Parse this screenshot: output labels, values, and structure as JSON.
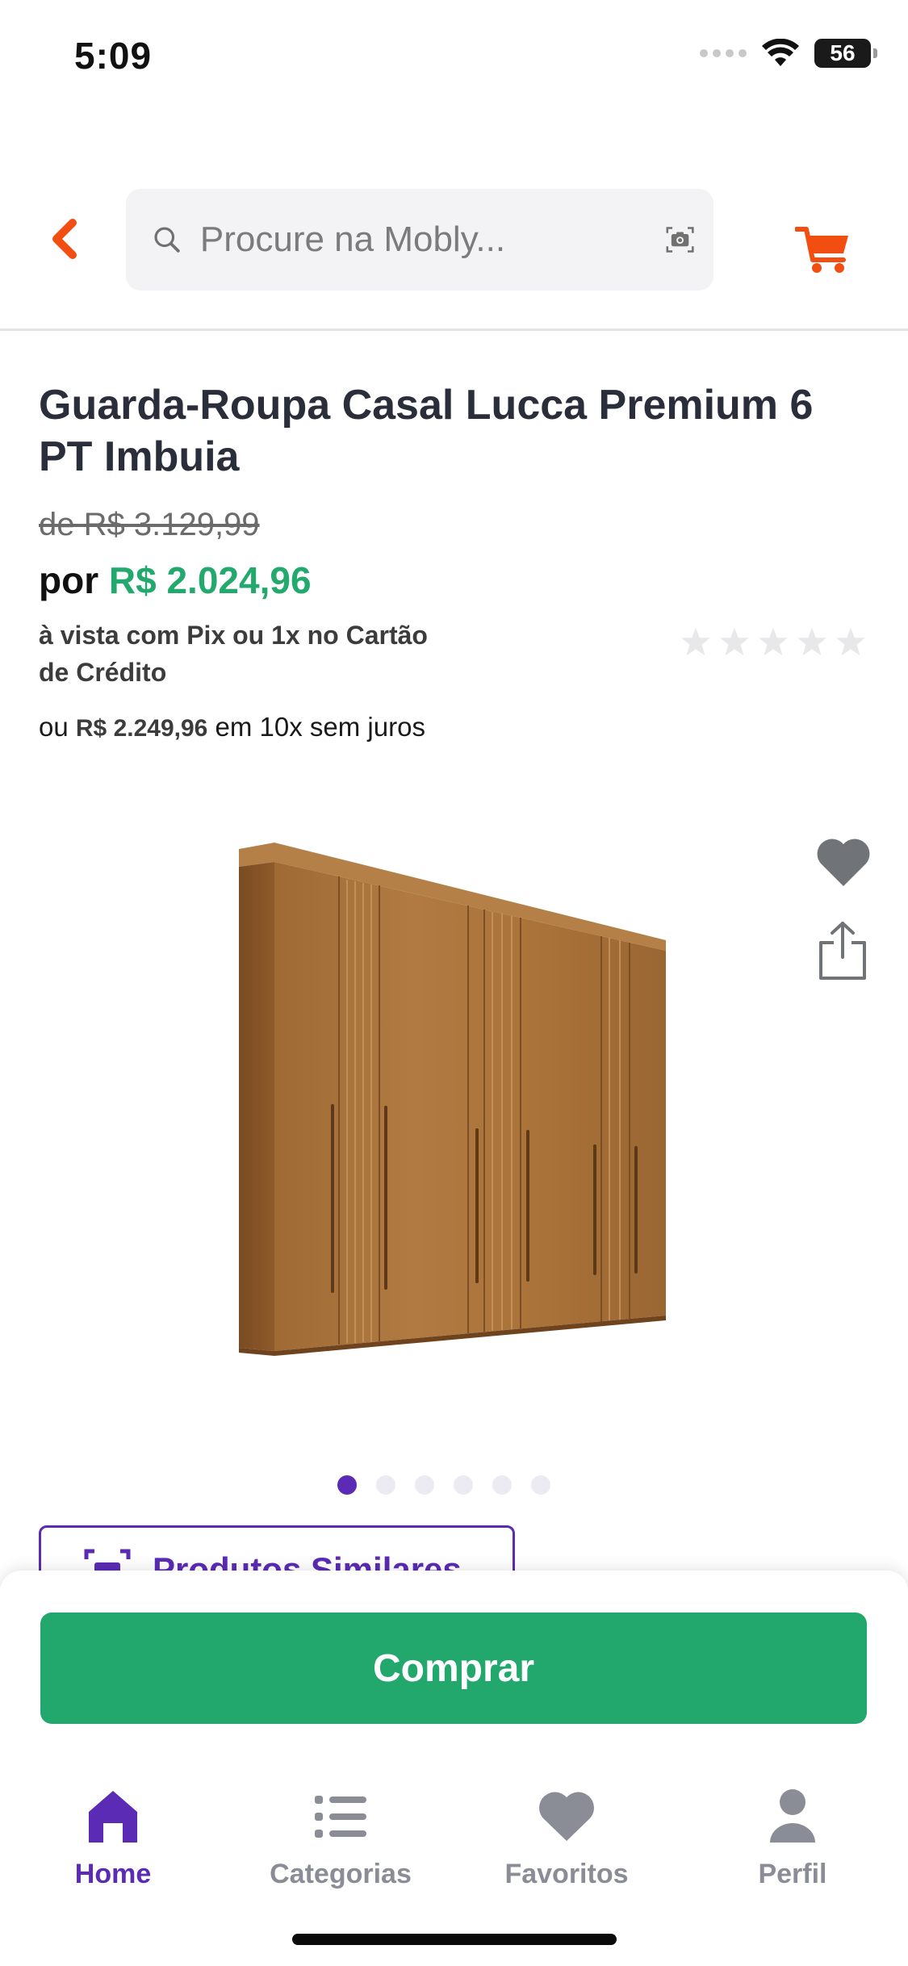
{
  "status_bar": {
    "time": "5:09",
    "battery": "56"
  },
  "header": {
    "search_placeholder": "Procure na Mobly...",
    "icons": [
      "back-arrow-icon",
      "search-icon",
      "camera-icon",
      "cart-icon"
    ]
  },
  "product": {
    "title": "Guarda-Roupa Casal Lucca Premium 6 PT Imbuia",
    "old_price_label": "de R$ 3.129,99",
    "new_price_prefix": "por",
    "new_price": "R$ 2.024,96",
    "pix_note": "à vista com Pix ou 1x no Cartão de Crédito",
    "installments_prefix": "ou",
    "installments_price": "R$ 2.249,96",
    "installments_suffix": "em 10x sem juros",
    "rating": {
      "stars_filled": 0,
      "stars_total": 5
    }
  },
  "gallery": {
    "image_count": 6,
    "active_index": 0
  },
  "similar": {
    "label": "Produtos Similares"
  },
  "buy": {
    "label": "Comprar"
  },
  "tabs": [
    {
      "label": "Home",
      "icon": "home-icon",
      "active": true
    },
    {
      "label": "Categorias",
      "icon": "list-icon",
      "active": false
    },
    {
      "label": "Favoritos",
      "icon": "heart-icon",
      "active": false
    },
    {
      "label": "Perfil",
      "icon": "user-icon",
      "active": false
    }
  ],
  "colors": {
    "accent_orange": "#f24e12",
    "price_green": "#23a96d",
    "button_green": "#22a86c",
    "brand_purple": "#5b2bb5",
    "inactive_gray": "#8a8d96"
  }
}
